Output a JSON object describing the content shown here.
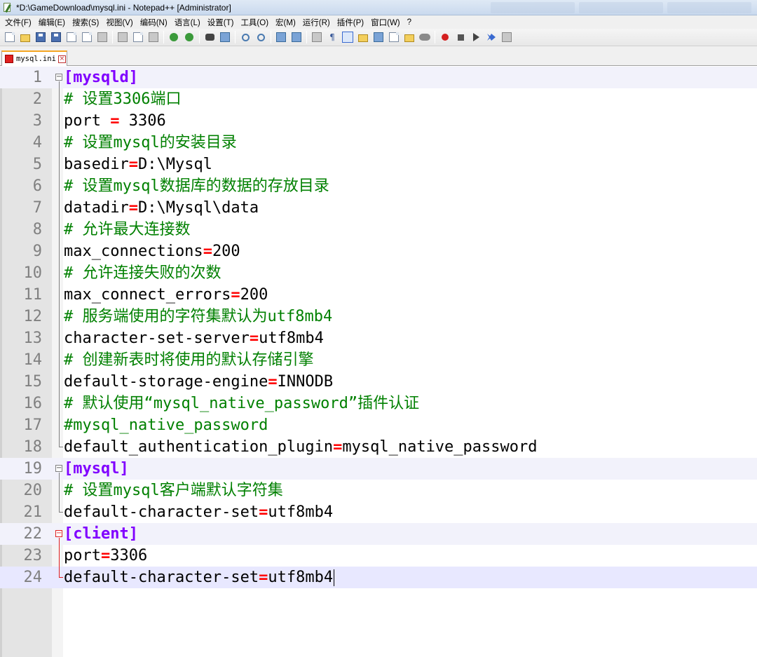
{
  "window": {
    "title": "*D:\\GameDownload\\mysql.ini - Notepad++ [Administrator]"
  },
  "menu": [
    "文件(F)",
    "编辑(E)",
    "搜索(S)",
    "视图(V)",
    "编码(N)",
    "语言(L)",
    "设置(T)",
    "工具(O)",
    "宏(M)",
    "运行(R)",
    "插件(P)",
    "窗口(W)",
    "?"
  ],
  "toolbar": {
    "icons": [
      "new-file-icon",
      "open-file-icon",
      "save-icon",
      "save-all-icon",
      "close-icon",
      "close-all-icon",
      "print-icon",
      "sep",
      "cut-icon",
      "copy-icon",
      "paste-icon",
      "sep",
      "undo-icon",
      "redo-icon",
      "sep",
      "find-icon",
      "replace-icon",
      "sep",
      "zoom-in-icon",
      "zoom-out-icon",
      "sep",
      "sync-vertical-icon",
      "sync-horizontal-icon",
      "sep",
      "word-wrap-icon",
      "show-all-chars-icon",
      "indent-guide-icon",
      "user-language-icon",
      "doc-map-icon",
      "function-list-icon",
      "folder-workspace-icon",
      "monitoring-icon",
      "sep",
      "record-macro-icon",
      "stop-record-icon",
      "playback-macro-icon",
      "run-macro-multiple-icon",
      "save-macro-icon"
    ]
  },
  "tab": {
    "label": "mysql.ini",
    "close_glyph": "×"
  },
  "editor": {
    "lines": [
      {
        "n": "1",
        "fold": "open",
        "tokens": [
          [
            "section",
            "[mysqld]"
          ]
        ]
      },
      {
        "n": "2",
        "fold": "line",
        "tokens": [
          [
            "comment",
            "# 设置3306端口"
          ]
        ]
      },
      {
        "n": "3",
        "fold": "line",
        "tokens": [
          [
            "key",
            "port "
          ],
          [
            "eq",
            "="
          ],
          [
            "val",
            " 3306"
          ]
        ]
      },
      {
        "n": "4",
        "fold": "line",
        "tokens": [
          [
            "comment",
            "# 设置mysql的安装目录"
          ]
        ]
      },
      {
        "n": "5",
        "fold": "line",
        "tokens": [
          [
            "key",
            "basedir"
          ],
          [
            "eq",
            "="
          ],
          [
            "val",
            "D:\\Mysql"
          ]
        ]
      },
      {
        "n": "6",
        "fold": "line",
        "tokens": [
          [
            "comment",
            "# 设置mysql数据库的数据的存放目录"
          ]
        ]
      },
      {
        "n": "7",
        "fold": "line",
        "tokens": [
          [
            "key",
            "datadir"
          ],
          [
            "eq",
            "="
          ],
          [
            "val",
            "D:\\Mysql\\data"
          ]
        ]
      },
      {
        "n": "8",
        "fold": "line",
        "tokens": [
          [
            "comment",
            "# 允许最大连接数"
          ]
        ]
      },
      {
        "n": "9",
        "fold": "line",
        "tokens": [
          [
            "key",
            "max_connections"
          ],
          [
            "eq",
            "="
          ],
          [
            "val",
            "200"
          ]
        ]
      },
      {
        "n": "10",
        "fold": "line",
        "tokens": [
          [
            "comment",
            "# 允许连接失败的次数"
          ]
        ]
      },
      {
        "n": "11",
        "fold": "line",
        "tokens": [
          [
            "key",
            "max_connect_errors"
          ],
          [
            "eq",
            "="
          ],
          [
            "val",
            "200"
          ]
        ]
      },
      {
        "n": "12",
        "fold": "line",
        "tokens": [
          [
            "comment",
            "# 服务端使用的字符集默认为utf8mb4"
          ]
        ]
      },
      {
        "n": "13",
        "fold": "line",
        "tokens": [
          [
            "key",
            "character-set-server"
          ],
          [
            "eq",
            "="
          ],
          [
            "val",
            "utf8mb4"
          ]
        ]
      },
      {
        "n": "14",
        "fold": "line",
        "tokens": [
          [
            "comment",
            "# 创建新表时将使用的默认存储引擎"
          ]
        ]
      },
      {
        "n": "15",
        "fold": "line",
        "tokens": [
          [
            "key",
            "default-storage-engine"
          ],
          [
            "eq",
            "="
          ],
          [
            "val",
            "INNODB"
          ]
        ]
      },
      {
        "n": "16",
        "fold": "line",
        "tokens": [
          [
            "comment",
            "# 默认使用“mysql_native_password”插件认证"
          ]
        ]
      },
      {
        "n": "17",
        "fold": "line",
        "tokens": [
          [
            "comment",
            "#mysql_native_password"
          ]
        ]
      },
      {
        "n": "18",
        "fold": "end",
        "tokens": [
          [
            "key",
            "default_authentication_plugin"
          ],
          [
            "eq",
            "="
          ],
          [
            "val",
            "mysql_native_password"
          ]
        ]
      },
      {
        "n": "19",
        "fold": "open",
        "tokens": [
          [
            "section",
            "[mysql]"
          ]
        ]
      },
      {
        "n": "20",
        "fold": "line",
        "tokens": [
          [
            "comment",
            "# 设置mysql客户端默认字符集"
          ]
        ]
      },
      {
        "n": "21",
        "fold": "end",
        "tokens": [
          [
            "key",
            "default-character-set"
          ],
          [
            "eq",
            "="
          ],
          [
            "val",
            "utf8mb4"
          ]
        ]
      },
      {
        "n": "22",
        "fold": "open-red",
        "tokens": [
          [
            "section",
            "[client]"
          ]
        ]
      },
      {
        "n": "23",
        "fold": "line-red",
        "tokens": [
          [
            "key",
            "port"
          ],
          [
            "eq",
            "="
          ],
          [
            "val",
            "3306"
          ]
        ]
      },
      {
        "n": "24",
        "fold": "end-red",
        "tokens": [
          [
            "key",
            "default-character-set"
          ],
          [
            "eq",
            "="
          ],
          [
            "val",
            "utf8mb4"
          ]
        ],
        "caret": true
      }
    ],
    "section_lines": [
      "1",
      "19",
      "22"
    ],
    "current_line": "24"
  },
  "colors": {
    "section": "#8000ff",
    "comment": "#008000",
    "operator": "#ff0000",
    "line_number": "#808080",
    "current_line_bg": "#e8e8ff",
    "tab_accent": "#f5a623"
  }
}
